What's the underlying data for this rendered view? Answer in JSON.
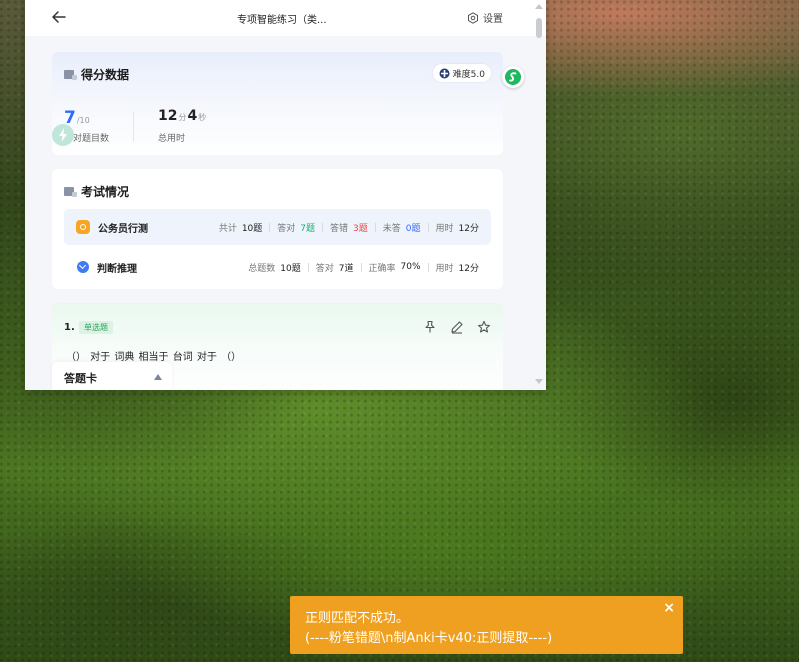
{
  "app": {
    "title": "专项智能练习（类...",
    "settings_label": "设置"
  },
  "score_card": {
    "title": "得分数据",
    "difficulty": "难度5.0",
    "correct_value": "7",
    "correct_total": "/10",
    "correct_label": "答对题目数",
    "time_minutes": "12",
    "time_minutes_unit": "分",
    "time_seconds": "4",
    "time_seconds_unit": "秒",
    "time_label": "总用时"
  },
  "exam_card": {
    "title": "考试情况",
    "rows": [
      {
        "name": "公务员行测",
        "stats": [
          {
            "label": "共计",
            "value": "10题",
            "tone": "normal"
          },
          {
            "label": "答对",
            "value": "7题",
            "tone": "green"
          },
          {
            "label": "答错",
            "value": "3题",
            "tone": "red"
          },
          {
            "label": "未答",
            "value": "0题",
            "tone": "blue"
          },
          {
            "label": "用时",
            "value": "12分",
            "tone": "normal"
          }
        ]
      },
      {
        "name": "判断推理",
        "stats": [
          {
            "label": "总题数",
            "value": "10题",
            "tone": "normal"
          },
          {
            "label": "答对",
            "value": "7道",
            "tone": "normal"
          },
          {
            "label": "正确率",
            "value": "70%",
            "tone": "normal"
          },
          {
            "label": "用时",
            "value": "12分",
            "tone": "normal"
          }
        ]
      }
    ]
  },
  "question": {
    "number": "1.",
    "type_tag": "单选题",
    "text": "（）  对于  词典  相当于  台词  对于  （）"
  },
  "answer_sheet": {
    "label": "答题卡"
  },
  "toast": {
    "line1": "正则匹配不成功。",
    "line2": "(----粉笔错题\\n制Anki卡v40:正则提取----)",
    "close": "×"
  },
  "colors": {
    "accent_blue": "#2f6bff",
    "correct_green": "#17b26a",
    "wrong_red": "#f0443a",
    "toast_orange": "#f0a020"
  }
}
